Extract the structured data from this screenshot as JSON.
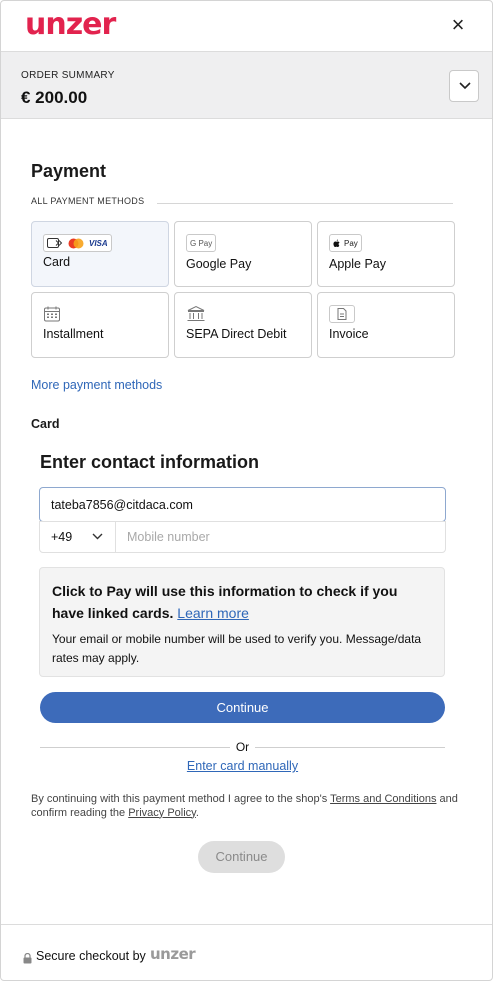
{
  "header": {
    "logo_text": "unzer",
    "close_icon": "×"
  },
  "summary": {
    "label": "ORDER SUMMARY",
    "amount": "€ 200.00"
  },
  "payment": {
    "title": "Payment",
    "methods_label": "ALL PAYMENT METHODS",
    "methods": [
      {
        "label": "Card",
        "icon": "card-brands-icon",
        "selected": true
      },
      {
        "label": "Google Pay",
        "icon": "google-pay-icon",
        "badge": "G Pay"
      },
      {
        "label": "Apple Pay",
        "icon": "apple-pay-icon",
        "badge": "Pay"
      },
      {
        "label": "Installment",
        "icon": "calendar-icon"
      },
      {
        "label": "SEPA Direct Debit",
        "icon": "bank-icon"
      },
      {
        "label": "Invoice",
        "icon": "document-icon"
      }
    ],
    "card_brands": {
      "visa": "VISA"
    },
    "more_link": "More payment methods",
    "selected_section_label": "Card"
  },
  "contact": {
    "title": "Enter contact information",
    "email_value": "tateba7856@citdaca.com",
    "country_code": "+49",
    "mobile_placeholder": "Mobile number",
    "info_title": "Click to Pay will use this information to check if you have linked cards.",
    "info_link": "Learn more",
    "info_body": "Your email or mobile number will be used to verify you. Message/data rates may apply.",
    "continue_label": "Continue",
    "or_text": "Or",
    "manual_link": "Enter card manually"
  },
  "terms": {
    "prefix": "By continuing with this payment method I agree to the shop's ",
    "terms_link": "Terms and Conditions",
    "middle": " and confirm reading the ",
    "privacy_link": "Privacy Policy",
    "suffix": "."
  },
  "submit": {
    "label": "Continue"
  },
  "footer": {
    "text": "Secure checkout by",
    "logo_text": "unzer"
  },
  "colors": {
    "brand": "#e2234e",
    "accent": "#3d6bba",
    "link": "#2f67b8"
  }
}
